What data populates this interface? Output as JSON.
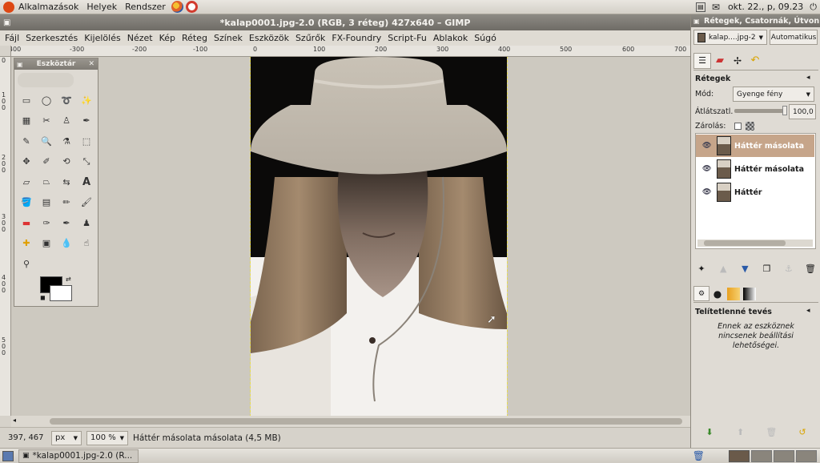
{
  "top_panel": {
    "menus": [
      "Alkalmazások",
      "Helyek",
      "Rendszer"
    ],
    "clock": "okt. 22., p, 09.23"
  },
  "image_window": {
    "title": "*kalap0001.jpg-2.0 (RGB, 3 réteg) 427x640 – GIMP",
    "menu": [
      "Fájl",
      "Szerkesztés",
      "Kijelölés",
      "Nézet",
      "Kép",
      "Réteg",
      "Színek",
      "Eszközök",
      "Szűrők",
      "FX-Foundry",
      "Script-Fu",
      "Ablakok",
      "Súgó"
    ],
    "ruler_h_labels": [
      "-400",
      "-300",
      "-200",
      "-100",
      "0",
      "100",
      "200",
      "300",
      "400",
      "500",
      "600",
      "700"
    ],
    "ruler_v_labels": [
      "0",
      "1 0 0",
      "2 0 0",
      "3 0 0",
      "4 0 0",
      "5 0 0"
    ],
    "status": {
      "coords": "397, 467",
      "unit": "px",
      "zoom": "100 %",
      "message": "Háttér másolata másolata (4,5 MB)"
    }
  },
  "toolbox": {
    "title": "Eszköztár"
  },
  "dock": {
    "title": "Rétegek, Csatornák, Útvon",
    "image_selector": "kalap....jpg-2",
    "auto_button": "Automatikus",
    "layers_heading": "Rétegek",
    "mode_label": "Mód:",
    "mode_value": "Gyenge fény",
    "opacity_label": "Átlátszatl.",
    "opacity_value": "100,0",
    "lock_label": "Zárolás:",
    "layers": [
      {
        "name": "Háttér másolata",
        "selected": true
      },
      {
        "name": "Háttér másolata",
        "selected": false
      },
      {
        "name": "Háttér",
        "selected": false
      }
    ],
    "tool_options_heading": "Telítetlenné tevés",
    "tool_options_message": "Ennek az eszköznek nincsenek beállítási lehetőségei."
  },
  "taskbar": {
    "window_button": "*kalap0001.jpg-2.0 (R..."
  }
}
